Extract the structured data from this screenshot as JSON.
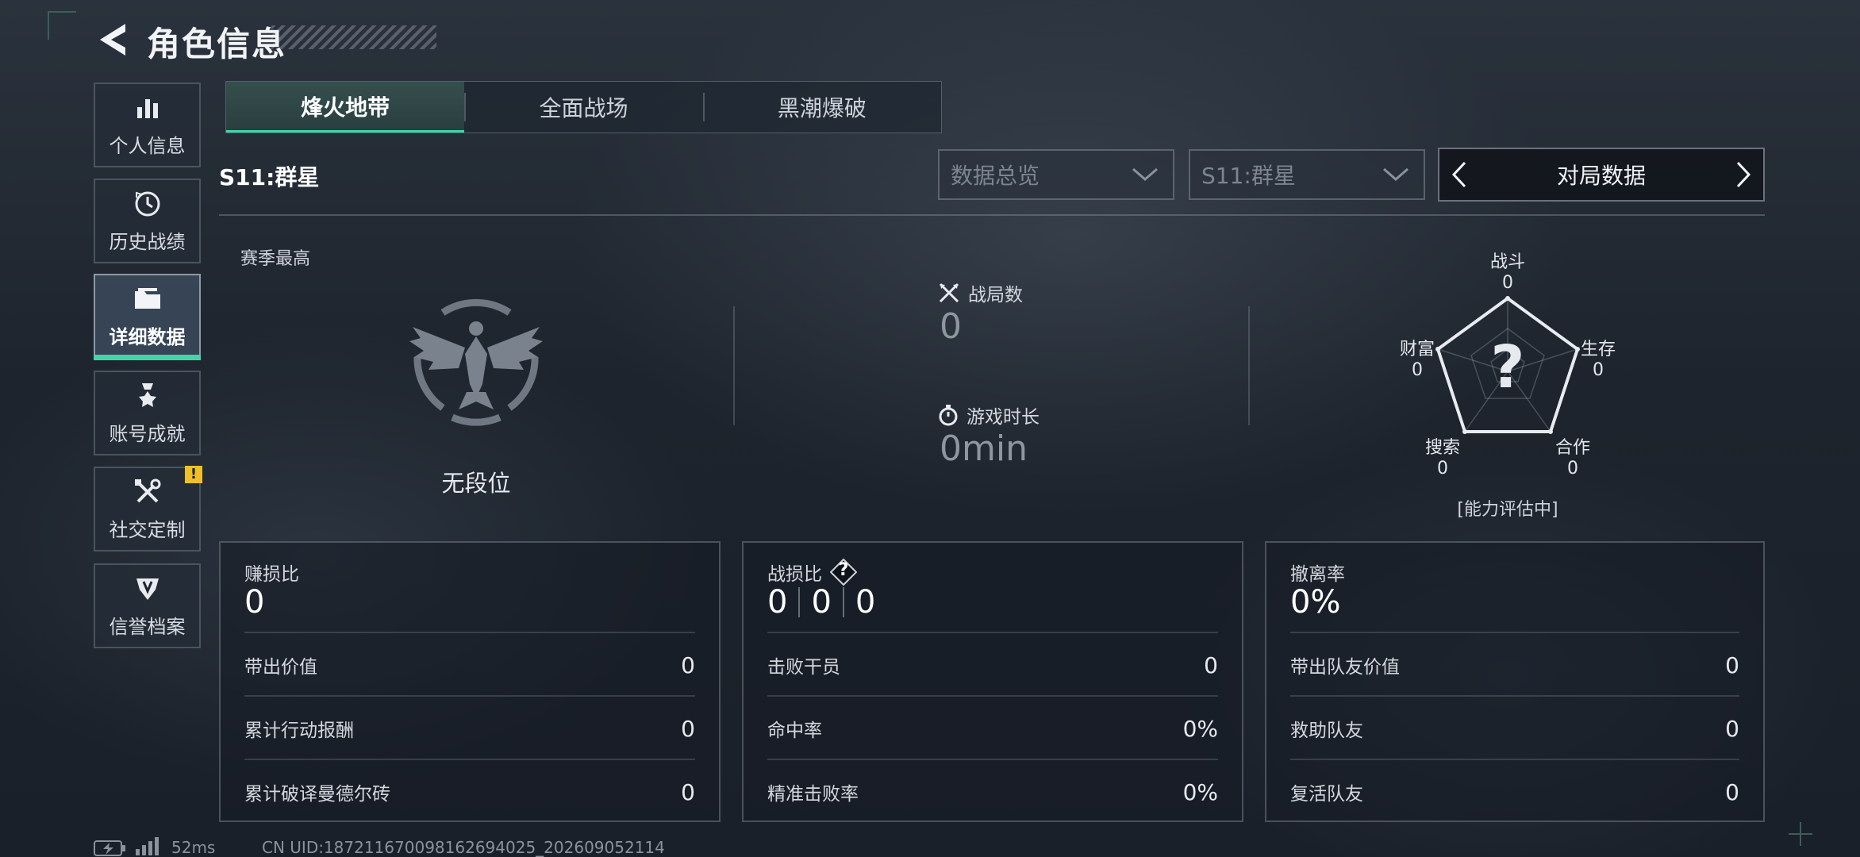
{
  "header": {
    "title": "角色信息"
  },
  "sidebar": {
    "items": [
      {
        "label": "个人信息",
        "icon": "bar-chart-icon"
      },
      {
        "label": "历史战绩",
        "icon": "history-clock-icon"
      },
      {
        "label": "详细数据",
        "icon": "folder-icon",
        "active": true
      },
      {
        "label": "账号成就",
        "icon": "medal-icon"
      },
      {
        "label": "社交定制",
        "icon": "tools-icon",
        "badge": "!"
      },
      {
        "label": "信誉档案",
        "icon": "shield-emblem-icon"
      }
    ]
  },
  "tabs": [
    {
      "label": "烽火地带",
      "active": true
    },
    {
      "label": "全面战场"
    },
    {
      "label": "黑潮爆破"
    }
  ],
  "season_label": "S11:群星",
  "filters": {
    "overview": "数据总览",
    "season": "S11:群星",
    "switcher": "对局数据"
  },
  "rank": {
    "heading": "赛季最高",
    "value": "无段位"
  },
  "summary": {
    "matches_label": "战局数",
    "matches_value": "0",
    "playtime_label": "游戏时长",
    "playtime_value": "0min"
  },
  "radar": {
    "combat": {
      "label": "战斗",
      "value": "0"
    },
    "survival": {
      "label": "生存",
      "value": "0"
    },
    "cooperation": {
      "label": "合作",
      "value": "0"
    },
    "search": {
      "label": "搜索",
      "value": "0"
    },
    "wealth": {
      "label": "财富",
      "value": "0"
    },
    "center_mark": "?",
    "status": "[能力评估中]"
  },
  "panels": {
    "profit": {
      "title": "赚损比",
      "value": "0",
      "rows": [
        {
          "label": "带出价值",
          "value": "0"
        },
        {
          "label": "累计行动报酬",
          "value": "0"
        },
        {
          "label": "累计破译曼德尔砖",
          "value": "0"
        }
      ]
    },
    "kd": {
      "title": "战损比",
      "help": "?",
      "values": [
        "0",
        "0",
        "0"
      ],
      "rows": [
        {
          "label": "击败干员",
          "value": "0"
        },
        {
          "label": "命中率",
          "value": "0%"
        },
        {
          "label": "精准击败率",
          "value": "0%"
        }
      ]
    },
    "extract": {
      "title": "撤离率",
      "value": "0%",
      "rows": [
        {
          "label": "带出队友价值",
          "value": "0"
        },
        {
          "label": "救助队友",
          "value": "0"
        },
        {
          "label": "复活队友",
          "value": "0"
        }
      ]
    }
  },
  "footer": {
    "ping": "52ms",
    "uid": "CN UID:187211670098162694025_202609052114"
  },
  "colors": {
    "accent": "#3fd7a7",
    "badge": "#f0c02a"
  }
}
